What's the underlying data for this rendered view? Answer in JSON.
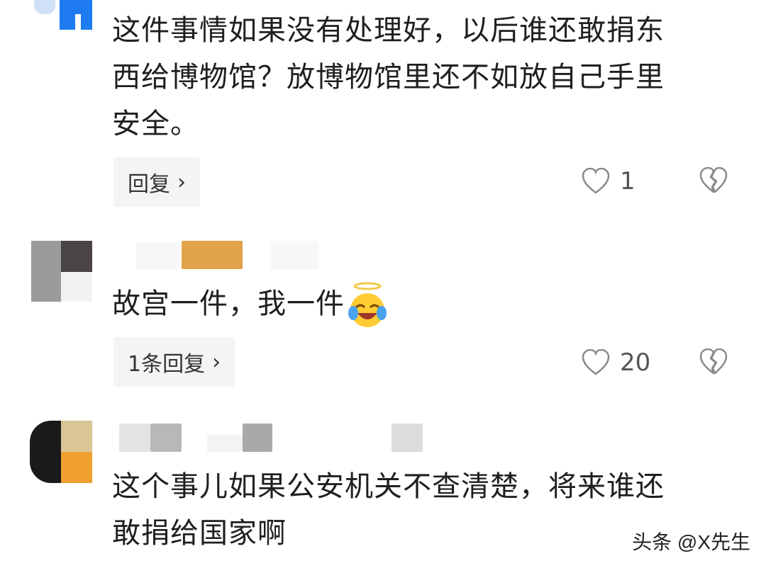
{
  "comments": [
    {
      "text_lines": [
        "这件事情如果没有处理好，以后谁还敢捐东",
        "西给博物馆？放博物馆里还不如放自己手里",
        "安全。"
      ],
      "reply_label": "回复",
      "like_count": "1",
      "icons": [
        "heart-icon",
        "broken-heart-icon",
        "chevron-right-icon"
      ]
    },
    {
      "text": "故宫一件，我一件",
      "emoji": "laughing-crying-emoji",
      "reply_label": "1条回复",
      "like_count": "20",
      "icons": [
        "heart-icon",
        "broken-heart-icon",
        "chevron-right-icon"
      ]
    },
    {
      "text_lines": [
        "这个事儿如果公安机关不查清楚，将来谁还",
        "敢捐给国家啊"
      ]
    }
  ],
  "watermark": "头条 @X先生",
  "colors": {
    "avatar_blue": "#1e7bf0",
    "name_orange": "#e0a24a",
    "icon_gray": "#8a8a8a",
    "reply_bg": "#f4f4f4"
  }
}
